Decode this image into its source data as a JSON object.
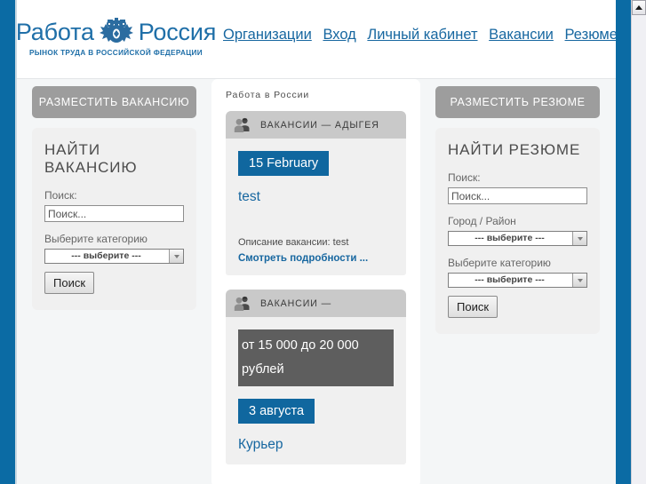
{
  "header": {
    "logo": {
      "word_left": "Работа",
      "word_right": "Россия",
      "tagline": "РЫНОК ТРУДА В РОССИЙСКОЙ ФЕДЕРАЦИИ",
      "emblem_icon": "russian-coat-of-arms-icon",
      "color": "#1f6fa8"
    },
    "nav": [
      {
        "label": "Организации"
      },
      {
        "label": "Вход"
      },
      {
        "label": "Личный кабинет"
      },
      {
        "label": "Вакансии"
      },
      {
        "label": "Резюме"
      }
    ]
  },
  "left_sidebar": {
    "post_button": "РАЗМЕСТИТЬ ВАКАНСИЮ",
    "panel": {
      "heading": "НАЙТИ ВАКАНСИЮ",
      "search_label": "Поиск:",
      "search_placeholder": "Поиск...",
      "search_value": "",
      "category_label": "Выберите категорию",
      "category_selected": "--- выберите ---",
      "submit": "Поиск"
    }
  },
  "right_sidebar": {
    "post_button": "РАЗМЕСТИТЬ РЕЗЮМЕ",
    "panel": {
      "heading": "НАЙТИ РЕЗЮМЕ",
      "search_label": "Поиск:",
      "search_placeholder": "Поиск...",
      "search_value": "",
      "city_label": "Город / Район",
      "city_selected": "--- выберите ---",
      "category_label": "Выберите категорию",
      "category_selected": "--- выберите ---",
      "submit": "Поиск"
    }
  },
  "center": {
    "title": "Работа в России",
    "cards": [
      {
        "head_icon": "group-people-icon",
        "head_title": "ВАКАНСИИ — АДЫГЕЯ",
        "salary": null,
        "date_badge": "15 February",
        "job_title": "test",
        "description": "Описание вакансии: test",
        "more_link": "Смотреть подробности ..."
      },
      {
        "head_icon": "group-people-icon",
        "head_title": "ВАКАНСИИ —",
        "salary": "от 15 000 до 20 000 рублей",
        "date_badge": "3 августа",
        "job_title": "Курьер",
        "description": null,
        "more_link": null
      }
    ]
  },
  "colors": {
    "brand_blue": "#0b6ba4",
    "badge_blue": "#10679f",
    "link_blue": "#1767a0",
    "gray_button": "#9d9d9d",
    "salary_gray": "#5e5e5e",
    "card_head_gray": "#c9c9c9",
    "panel_gray": "#f0f0f0"
  },
  "scrollbar": {
    "up_arrow": "scroll-up-arrow-icon"
  }
}
